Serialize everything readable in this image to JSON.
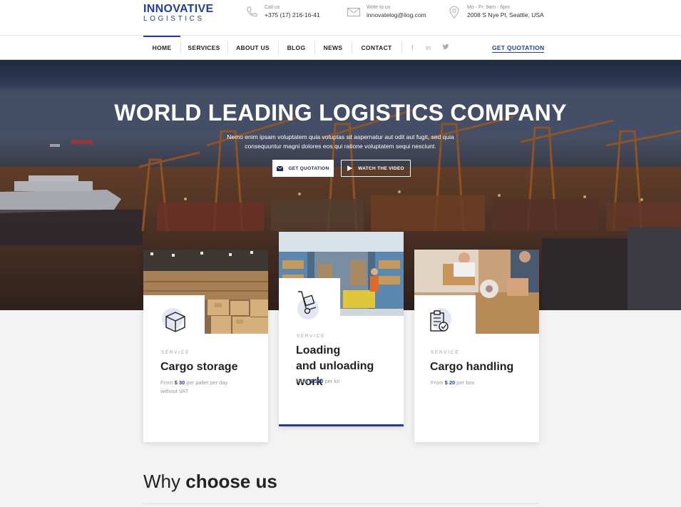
{
  "brand": {
    "name": "INNOVATIVE",
    "tagline": "LOGISTICS",
    "accent": "#1f3fa0"
  },
  "contacts": [
    {
      "icon": "phone-icon",
      "label": "Call us",
      "value": "+375 (17) 216-16-41"
    },
    {
      "icon": "envelope-icon",
      "label": "Write to us",
      "value": "innovatelog@ilog.com"
    },
    {
      "icon": "location-pin-icon",
      "label": "Mo - Fr: 9am - 6pm",
      "value": "2008 S Nye Pl, Seattle, USA"
    }
  ],
  "nav": {
    "items": [
      "HOME",
      "SERVICES",
      "ABOUT US",
      "BLOG",
      "NEWS",
      "CONTACT"
    ],
    "active": "HOME",
    "social": [
      "f",
      "in",
      "twitter-icon"
    ],
    "cta": "GET QUOTATION"
  },
  "hero": {
    "title": "WORLD LEADING LOGISTICS COMPANY",
    "text_line1": "Nemo enim ipsam voluptatem quia voluptas sit aspernatur aut odit aut fugit, sed quia",
    "text_line2": "consequuntur magni dolores eos qui ratione voluptatem sequi nesciunt.",
    "btn_quote": "GET QUOTATION",
    "btn_video": "WATCH THE VIDEO"
  },
  "cards": [
    {
      "icon": "box-icon",
      "kicker": "SERVICE",
      "title_line1": "Cargo storage",
      "title_line2": "",
      "price_prefix": "From",
      "price": "$ 30",
      "price_suffix": "per pallet per day",
      "price_note": "without VAT"
    },
    {
      "icon": "hand-truck-icon",
      "kicker": "SERVICE",
      "title_line1": "Loading",
      "title_line2": "and unloading work",
      "price_prefix": "From",
      "price": "$ 100",
      "price_suffix": "per lot",
      "price_note": ""
    },
    {
      "icon": "clipboard-check-icon",
      "kicker": "SERVICE",
      "title_line1": "Cargo handling",
      "title_line2": "",
      "price_prefix": "From",
      "price": "$ 20",
      "price_suffix": "per box",
      "price_note": ""
    }
  ],
  "why": {
    "part1": "Why ",
    "part2": "choose us"
  }
}
